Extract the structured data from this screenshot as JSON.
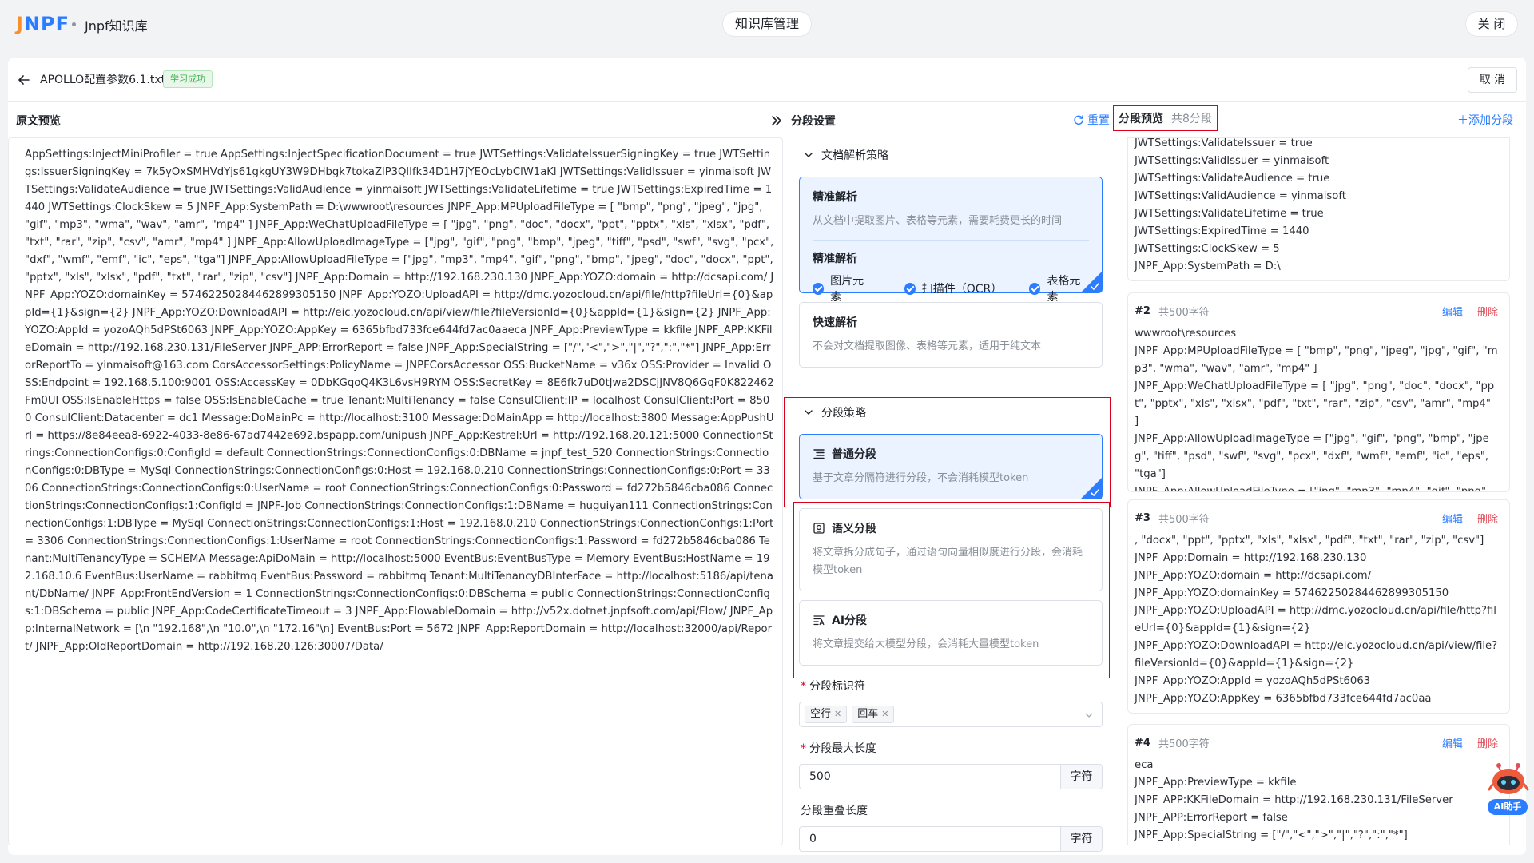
{
  "app": {
    "logo_j": "J",
    "logo_rest": "NPF",
    "name": "Jnpf知识库"
  },
  "header": {
    "center_title": "知识库管理",
    "close_label": "关 闭"
  },
  "doc": {
    "title": "APOLLO配置参数6.1.txt",
    "status": "学习成功",
    "cancel_label": "取 消"
  },
  "left": {
    "title": "原文预览",
    "content": "AppSettings:InjectMiniProfiler = true AppSettings:InjectSpecificationDocument = true JWTSettings:ValidateIssuerSigningKey = true JWTSettings:IssuerSigningKey = 7k5yOxSMHVdYjs61gkgUY3W9DHbgk7tokaZlP3QlIfk34D1H7jYEOcLybClW1aKl JWTSettings:ValidIssuer = yinmaisoft JWTSettings:ValidateAudience = true JWTSettings:ValidAudience = yinmaisoft JWTSettings:ValidateLifetime = true JWTSettings:ExpiredTime = 1440 JWTSettings:ClockSkew = 5 JNPF_App:SystemPath = D:\\wwwroot\\resources JNPF_App:MPUploadFileType = [ \"bmp\", \"png\", \"jpeg\", \"jpg\", \"gif\", \"mp3\", \"wma\", \"wav\", \"amr\", \"mp4\" ] JNPF_App:WeChatUploadFileType = [ \"jpg\", \"png\", \"doc\", \"docx\", \"ppt\", \"pptx\", \"xls\", \"xlsx\", \"pdf\", \"txt\", \"rar\", \"zip\", \"csv\", \"amr\", \"mp4\" ] JNPF_App:AllowUploadImageType = [\"jpg\", \"gif\", \"png\", \"bmp\", \"jpeg\", \"tiff\", \"psd\", \"swf\", \"svg\", \"pcx\", \"dxf\", \"wmf\", \"emf\", \"ic\", \"eps\", \"tga\"] JNPF_App:AllowUploadFileType = [\"jpg\", \"mp3\", \"mp4\", \"gif\", \"png\", \"bmp\", \"jpeg\", \"doc\", \"docx\", \"ppt\", \"pptx\", \"xls\", \"xlsx\", \"pdf\", \"txt\", \"rar\", \"zip\", \"csv\"] JNPF_App:Domain = http://192.168.230.130 JNPF_App:YOZO:domain = http://dcsapi.com/ JNPF_App:YOZO:domainKey = 57462250284462899305150 JNPF_App:YOZO:UploadAPI = http://dmc.yozocloud.cn/api/file/http?fileUrl={0}&appId={1}&sign={2} JNPF_App:YOZO:DownloadAPI = http://eic.yozocloud.cn/api/view/file?fileVersionId={0}&appId={1}&sign={2} JNPF_App:YOZO:AppId = yozoAQh5dPSt6063 JNPF_App:YOZO:AppKey = 6365bfbd733fce644fd7ac0aaeca JNPF_App:PreviewType = kkfile JNPF_APP:KKFileDomain = http://192.168.230.131/FileServer JNPF_APP:ErrorReport = false JNPF_App:SpecialString = [\"/\",\"<\",\">\",\"|\",\"?\",\":\",\"*\"] JNPF_App:ErrorReportTo = yinmaisoft@163.com CorsAccessorSettings:PolicyName = JNPFCorsAccessor OSS:BucketName = v36x OSS:Provider = Invalid OSS:Endpoint = 192.168.5.100:9001 OSS:AccessKey = 0DbKGqoQ4K3L6vsH9RYM OSS:SecretKey = 8E6fk7uD0tJwa2DSCjJNV8Q6GqF0K822462Fm0UI OSS:IsEnableHttps = false OSS:IsEnableCache = true Tenant:MultiTenancy = false ConsulClient:IP = localhost ConsulClient:Port = 8500 ConsulClient:Datacenter = dc1 Message:DoMainPc = http://localhost:3100 Message:DoMainApp = http://localhost:3800 Message:AppPushUrl = https://8e84eea8-6922-4033-8e86-67ad7442e692.bspapp.com/unipush JNPF_App:Kestrel:Url = http://192.168.20.121:5000 ConnectionStrings:ConnectionConfigs:0:ConfigId = default ConnectionStrings:ConnectionConfigs:0:DBName = jnpf_test_520 ConnectionStrings:ConnectionConfigs:0:DBType = MySql ConnectionStrings:ConnectionConfigs:0:Host = 192.168.0.210 ConnectionStrings:ConnectionConfigs:0:Port = 3306 ConnectionStrings:ConnectionConfigs:0:UserName = root ConnectionStrings:ConnectionConfigs:0:Password = fd272b5846cba086 ConnectionStrings:ConnectionConfigs:1:ConfigId = JNPF-Job ConnectionStrings:ConnectionConfigs:1:DBName = huguiyan111 ConnectionStrings:ConnectionConfigs:1:DBType = MySql ConnectionStrings:ConnectionConfigs:1:Host = 192.168.0.210 ConnectionStrings:ConnectionConfigs:1:Port = 3306 ConnectionStrings:ConnectionConfigs:1:UserName = root ConnectionStrings:ConnectionConfigs:1:Password = fd272b5846cba086 Tenant:MultiTenancyType = SCHEMA Message:ApiDoMain = http://localhost:5000 EventBus:EventBusType = Memory EventBus:HostName = 192.168.10.6 EventBus:UserName = rabbitmq EventBus:Password = rabbitmq Tenant:MultiTenancyDBInterFace = http://localhost:5186/api/tenant/DbName/ JNPF_App:FrontEndVersion = 1 ConnectionStrings:ConnectionConfigs:0:DBSchema = public ConnectionStrings:ConnectionConfigs:1:DBSchema = public JNPF_App:CodeCertificateTimeout = 3 JNPF_App:FlowableDomain = http://v52x.dotnet.jnpfsoft.com/api/Flow/ JNPF_App:InternalNetwork = [\\n \"192.168\",\\n \"10.0\",\\n \"172.16\"\\n] EventBus:Port = 5672 JNPF_App:ReportDomain = http://localhost:32000/api/Report/ JNPF_App:OldReportDomain = http://192.168.20.126:30007/Data/"
  },
  "settings": {
    "title": "分段设置",
    "reset_label": "重置",
    "parse_group": "文档解析策略",
    "precise": {
      "title": "精准解析",
      "desc": "从文档中提取图片、表格等元素，需要耗费更长的时间",
      "sub_title": "精准解析",
      "options": [
        "图片元素",
        "扫描件（OCR）",
        "表格元素"
      ]
    },
    "fast": {
      "title": "快速解析",
      "desc": "不会对文档提取图像、表格等元素，适用于纯文本"
    },
    "strategy_group": "分段策略",
    "normal": {
      "title": "普通分段",
      "desc": "基于文章分隔符进行分段，不会消耗模型token"
    },
    "semantic": {
      "title": "语义分段",
      "desc": "将文章拆分成句子，通过语句向量相似度进行分段，会消耗模型token"
    },
    "ai": {
      "title": "AI分段",
      "desc": "将文章提交给大模型分段，会消耗大量模型token"
    },
    "identifier_label": "分段标识符",
    "identifier_tags": [
      "空行",
      "回车"
    ],
    "max_len_label": "分段最大长度",
    "max_len_value": "500",
    "overlap_label": "分段重叠长度",
    "overlap_value": "0",
    "unit": "字符"
  },
  "preview": {
    "title": "分段预览",
    "count": "共8分段",
    "add_label": "添加分段",
    "edit_label": "编辑",
    "delete_label": "删除",
    "segments": [
      {
        "lines": [
          "JWTSettings:ValidateIssuer = true",
          "JWTSettings:ValidIssuer = yinmaisoft",
          "JWTSettings:ValidateAudience = true",
          "JWTSettings:ValidAudience = yinmaisoft",
          "JWTSettings:ValidateLifetime = true",
          "JWTSettings:ExpiredTime = 1440",
          "JWTSettings:ClockSkew = 5",
          "JNPF_App:SystemPath = D:\\"
        ]
      },
      {
        "no": "#2",
        "chars": "共500字符",
        "lines": [
          "wwwroot\\resources",
          "JNPF_App:MPUploadFileType = [ \"bmp\", \"png\", \"jpeg\", \"jpg\", \"gif\", \"mp3\", \"wma\", \"wav\", \"amr\", \"mp4\" ]",
          "JNPF_App:WeChatUploadFileType = [ \"jpg\", \"png\", \"doc\", \"docx\", \"ppt\", \"pptx\", \"xls\", \"xlsx\", \"pdf\", \"txt\", \"rar\", \"zip\", \"csv\", \"amr\", \"mp4\" ]",
          "JNPF_App:AllowUploadImageType = [\"jpg\", \"gif\", \"png\", \"bmp\", \"jpeg\", \"tiff\", \"psd\", \"swf\", \"svg\", \"pcx\", \"dxf\", \"wmf\", \"emf\", \"ic\", \"eps\", \"tga\"]",
          "JNPF_App:AllowUploadFileType = [\"jpg\", \"mp3\", \"mp4\", \"gif\", \"png\", \"bmp\", \"jpeg\", \"doc\""
        ]
      },
      {
        "no": "#3",
        "chars": "共500字符",
        "lines": [
          ", \"docx\", \"ppt\", \"pptx\", \"xls\", \"xlsx\", \"pdf\", \"txt\", \"rar\", \"zip\", \"csv\"]",
          "JNPF_App:Domain = http://192.168.230.130",
          "JNPF_App:YOZO:domain = http://dcsapi.com/",
          "JNPF_App:YOZO:domainKey = 57462250284462899305150",
          "JNPF_App:YOZO:UploadAPI = http://dmc.yozocloud.cn/api/file/http?fileUrl={0}&appId={1}&sign={2}",
          "JNPF_App:YOZO:DownloadAPI = http://eic.yozocloud.cn/api/view/file?fileVersionId={0}&appId={1}&sign={2}",
          "JNPF_App:YOZO:AppId = yozoAQh5dPSt6063",
          "JNPF_App:YOZO:AppKey = 6365bfbd733fce644fd7ac0aa"
        ]
      },
      {
        "no": "#4",
        "chars": "共500字符",
        "lines": [
          "eca",
          "JNPF_App:PreviewType = kkfile",
          "JNPF_APP:KKFileDomain = http://192.168.230.131/FileServer",
          "JNPF_APP:ErrorReport = false",
          "JNPF_App:SpecialString = [\"/\",\"<\",\">\",\"|\",\"?\",\":\",\"*\"]"
        ]
      }
    ]
  },
  "ai_helper": {
    "label": "AI助手"
  },
  "colors": {
    "accent": "#2b7cff",
    "success": "#3cb34d",
    "danger": "#e34d59",
    "highlight_border": "#d9001b",
    "logo_orange": "#f7902b"
  }
}
